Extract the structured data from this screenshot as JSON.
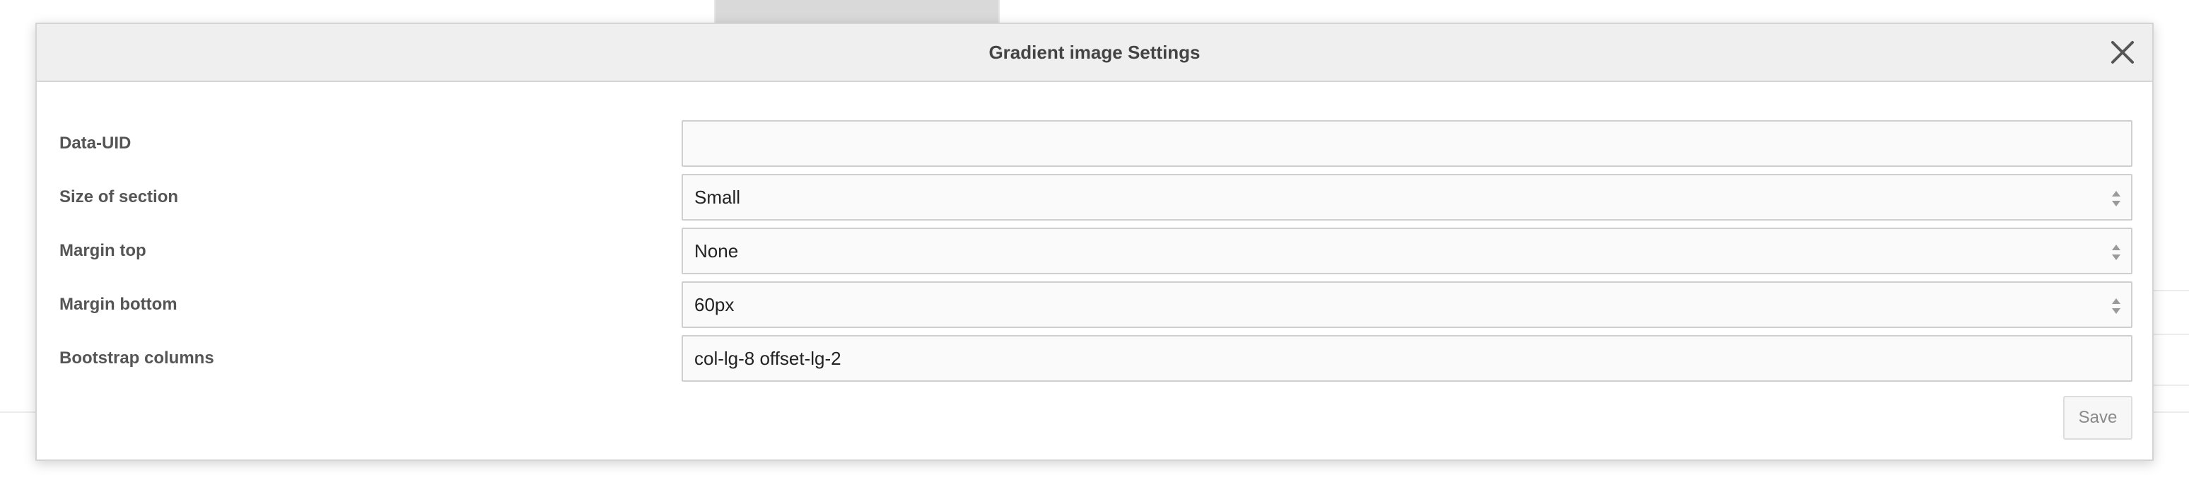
{
  "modal": {
    "title": "Gradient image Settings",
    "close_icon": "close-icon",
    "save_label": "Save"
  },
  "fields": {
    "data_uid": {
      "label": "Data-UID",
      "value": ""
    },
    "size_of_section": {
      "label": "Size of section",
      "value": "Small"
    },
    "margin_top": {
      "label": "Margin top",
      "value": "None"
    },
    "margin_bottom": {
      "label": "Margin bottom",
      "value": "60px"
    },
    "bootstrap_columns": {
      "label": "Bootstrap columns",
      "value": "col-lg-8 offset-lg-2"
    }
  },
  "colors": {
    "header_bg": "#efefef",
    "label_text": "#555555",
    "input_bg": "#fafafa",
    "input_border": "#cfcfcf"
  }
}
